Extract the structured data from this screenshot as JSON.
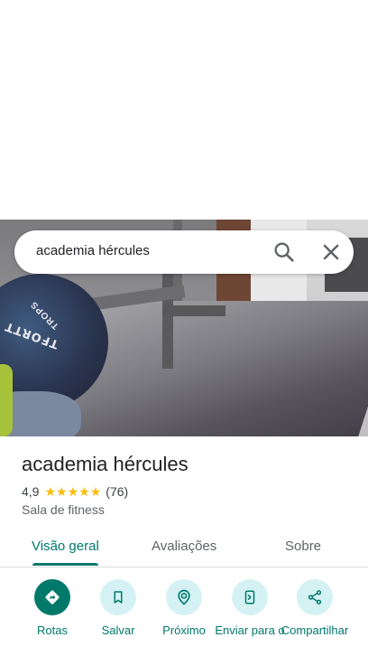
{
  "search": {
    "query": "academia hércules",
    "search_icon": "search-icon",
    "clear_icon": "close-icon"
  },
  "place": {
    "name": "academia hércules",
    "rating": "4,9",
    "stars": 5,
    "review_count": "(76)",
    "category": "Sala de fitness"
  },
  "photo": {
    "shirt_text_1": "TFORTT",
    "shirt_text_2": "TROPS"
  },
  "tabs": [
    {
      "label": "Visão geral",
      "active": true
    },
    {
      "label": "Avaliações",
      "active": false
    },
    {
      "label": "Sobre",
      "active": false
    }
  ],
  "actions": [
    {
      "label": "Rotas",
      "icon": "directions-icon",
      "primary": true
    },
    {
      "label": "Salvar",
      "icon": "bookmark-icon",
      "primary": false
    },
    {
      "label": "Próximo",
      "icon": "nearby-icon",
      "primary": false
    },
    {
      "label": "Enviar para o",
      "icon": "send-to-phone-icon",
      "primary": false
    },
    {
      "label": "Compartilhar",
      "icon": "share-icon",
      "primary": false
    }
  ],
  "colors": {
    "accent": "#00796b",
    "action_bg": "#d4f2f4",
    "star": "#fbbc04"
  }
}
